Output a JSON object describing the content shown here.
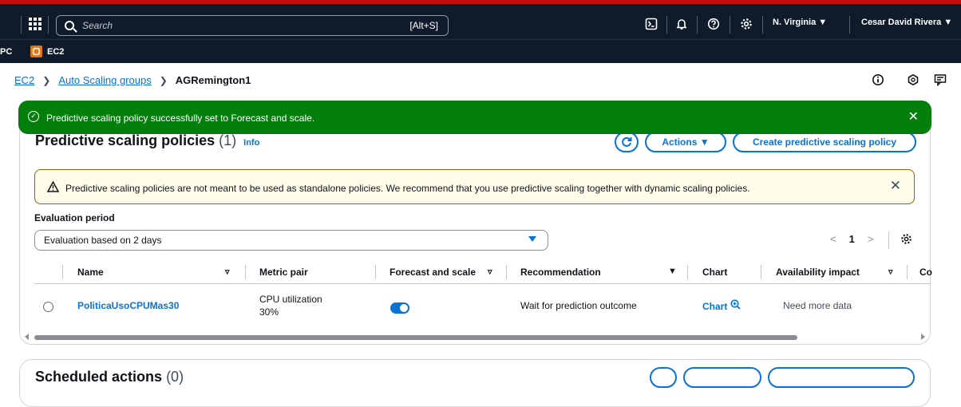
{
  "topbar": {
    "search_placeholder": "Search",
    "search_shortcut": "[Alt+S]",
    "region": "N. Virginia ▼",
    "user": "Cesar David Rivera ▼",
    "icons": [
      "grid-icon",
      "search-icon",
      "cloudshell-icon",
      "bell-icon",
      "help-icon",
      "settings-icon"
    ]
  },
  "servicebar": {
    "partial": "PC",
    "ec2": "EC2"
  },
  "breadcrumb": {
    "items": [
      "EC2",
      "Auto Scaling groups"
    ],
    "current": "AGRemington1"
  },
  "flash": {
    "message": "Predictive scaling policy successfully set to Forecast and scale."
  },
  "panel": {
    "title": "Predictive scaling policies",
    "count": "(1)",
    "info": "Info",
    "actions": "Actions ▼",
    "create": "Create predictive scaling policy"
  },
  "warning": {
    "message": "Predictive scaling policies are not meant to be used as standalone policies. We recommend that you use predictive scaling together with dynamic scaling policies."
  },
  "evaluation": {
    "label": "Evaluation period",
    "selected": "Evaluation based on 2 days"
  },
  "pagination": {
    "prev": "<",
    "page": "1",
    "next": ">"
  },
  "table": {
    "headers": [
      "Name",
      "Metric pair",
      "Forecast and scale",
      "Recommendation",
      "Chart",
      "Availability impact",
      "Co"
    ],
    "rows": [
      {
        "name": "PoliticaUsoCPUMas30",
        "metric_line1": "CPU utilization",
        "metric_line2": "30%",
        "forecast_enabled": true,
        "recommendation": "Wait for prediction outcome",
        "chart": "Chart",
        "availability": "Need more data"
      }
    ]
  },
  "scheduled": {
    "title": "Scheduled actions",
    "count": "(0)"
  }
}
